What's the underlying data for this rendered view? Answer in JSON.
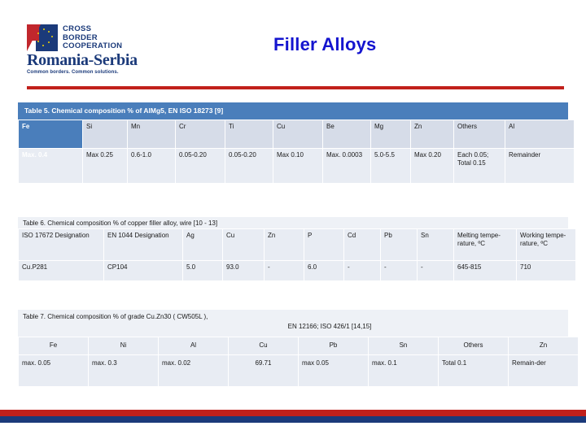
{
  "header": {
    "logo": {
      "line1": "CROSS",
      "line2": "BORDER",
      "line3": "COOPERATION",
      "country": "Romania-Serbia",
      "tagline": "Common borders. Common solutions."
    },
    "title": "Filler Alloys",
    "accent_red": "#c1201b",
    "accent_blue": "#1b3a7a",
    "title_color": "#1414cf"
  },
  "table5": {
    "caption": "Table 5. Chemical composition % of AlMg5, EN ISO 18273 [9]",
    "caption_bg": "#4a7ebb",
    "selected_column": "Fe",
    "headers": [
      "Fe",
      "Si",
      "Mn",
      "Cr",
      "Ti",
      "Cu",
      "Be",
      "Mg",
      "Zn",
      "Others",
      "Al"
    ],
    "rows": [
      [
        "Max. 0.4",
        "Max 0.25",
        "0.6-1.0",
        "0.05-0.20",
        "0.05-0.20",
        "Max 0.10",
        "Max. 0.0003",
        "5.0-5.5",
        "Max 0.20",
        "Each 0.05; Total 0.15",
        "Remainder"
      ]
    ]
  },
  "table6": {
    "caption": "Table 6.  Chemical composition %  of copper filler alloy, wire [10 - 13]",
    "headers": [
      "ISO 17672 Designation",
      "EN 1044 Designation",
      "Ag",
      "Cu",
      "Zn",
      "P",
      "Cd",
      "Pb",
      "Sn",
      "Melting tempe-rature, ºC",
      "Working tempe-rature, ºC"
    ],
    "rows": [
      [
        "Cu.P281",
        "CP104",
        "5.0",
        "93.0",
        "-",
        "6.0",
        "-",
        "-",
        "-",
        "645-815",
        "710"
      ]
    ]
  },
  "table7": {
    "caption_line1": "Table 7.  Chemical composition % of grade Cu.Zn30 ( CW505L ),",
    "caption_line2": "EN 12166; ISO 426/1  [14,15]",
    "headers": [
      "Fe",
      "Ni",
      "Al",
      "Cu",
      "Pb",
      "Sn",
      "Others",
      "Zn"
    ],
    "rows": [
      [
        "max. 0.05",
        "max. 0.3",
        "max. 0.02",
        "69.71",
        "max 0.05",
        "max. 0.1",
        "Total 0.1",
        "Remain-der"
      ]
    ]
  }
}
